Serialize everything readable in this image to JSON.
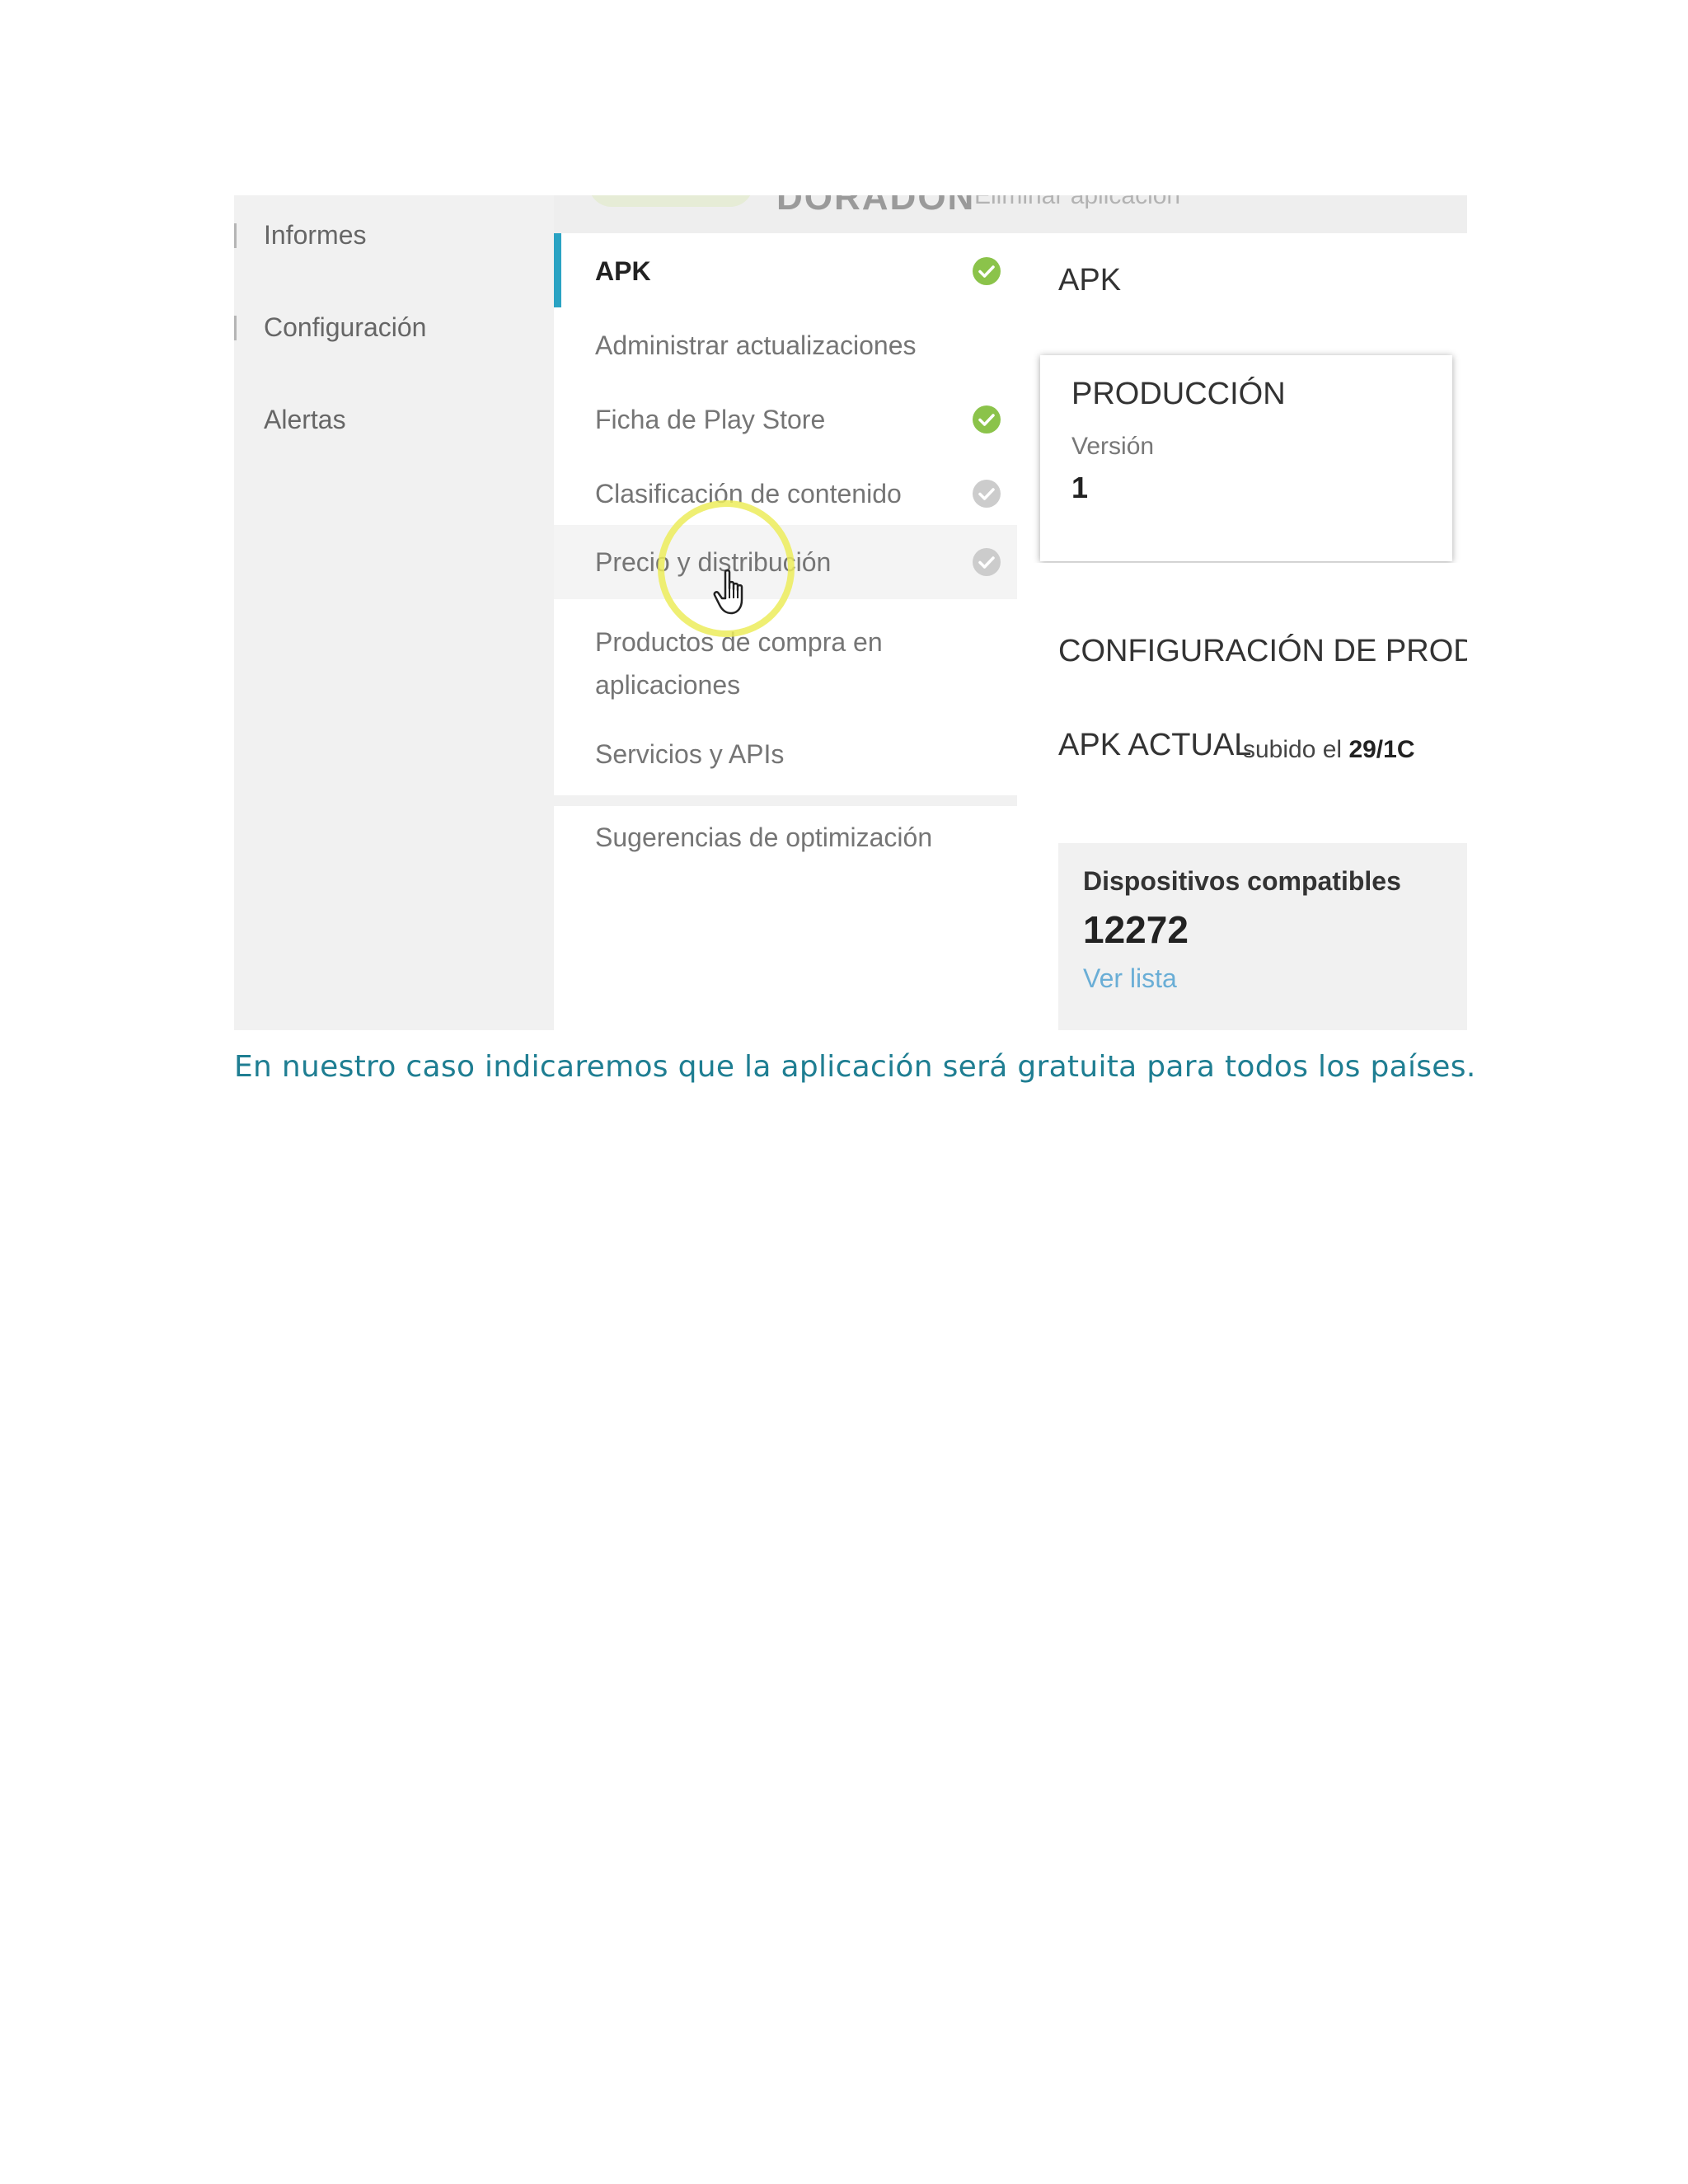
{
  "left_nav": {
    "items": [
      {
        "label": "Informes"
      },
      {
        "label": "Configuración"
      },
      {
        "label": "Alertas"
      }
    ]
  },
  "header": {
    "app_name": "DORADON",
    "subtitle": "Eliminar aplicación"
  },
  "menu": {
    "items": [
      {
        "label": "APK",
        "status": "complete"
      },
      {
        "label": "Administrar actualizaciones",
        "status": "none"
      },
      {
        "label": "Ficha de Play Store",
        "status": "complete"
      },
      {
        "label": "Clasificación de contenido",
        "status": "incomplete"
      },
      {
        "label": "Precio y distribución",
        "status": "incomplete"
      },
      {
        "label": "Productos de compra en aplicaciones",
        "status": "none"
      },
      {
        "label": "Servicios y APIs",
        "status": "none"
      }
    ],
    "secondary": [
      {
        "label": "Sugerencias de optimización"
      }
    ]
  },
  "content": {
    "title": "APK",
    "production": {
      "label": "PRODUCCIÓN",
      "version_label": "Versión",
      "version": "1"
    },
    "config_title": "CONFIGURACIÓN DE PROD",
    "apk_actual": "APK ACTUAL",
    "uploaded_prefix": "subido el",
    "uploaded_date": "29/1C",
    "devices": {
      "label": "Dispositivos compatibles",
      "count": "12272",
      "link": "Ver lista"
    }
  },
  "colors": {
    "accent": "#2aa3c3",
    "complete": "#8bc34a",
    "incomplete": "#cccccc",
    "link": "#6aaed6",
    "caption": "#1f7e92"
  },
  "caption": "En nuestro caso indicaremos  que la aplicación  será gratuita para todos los países."
}
